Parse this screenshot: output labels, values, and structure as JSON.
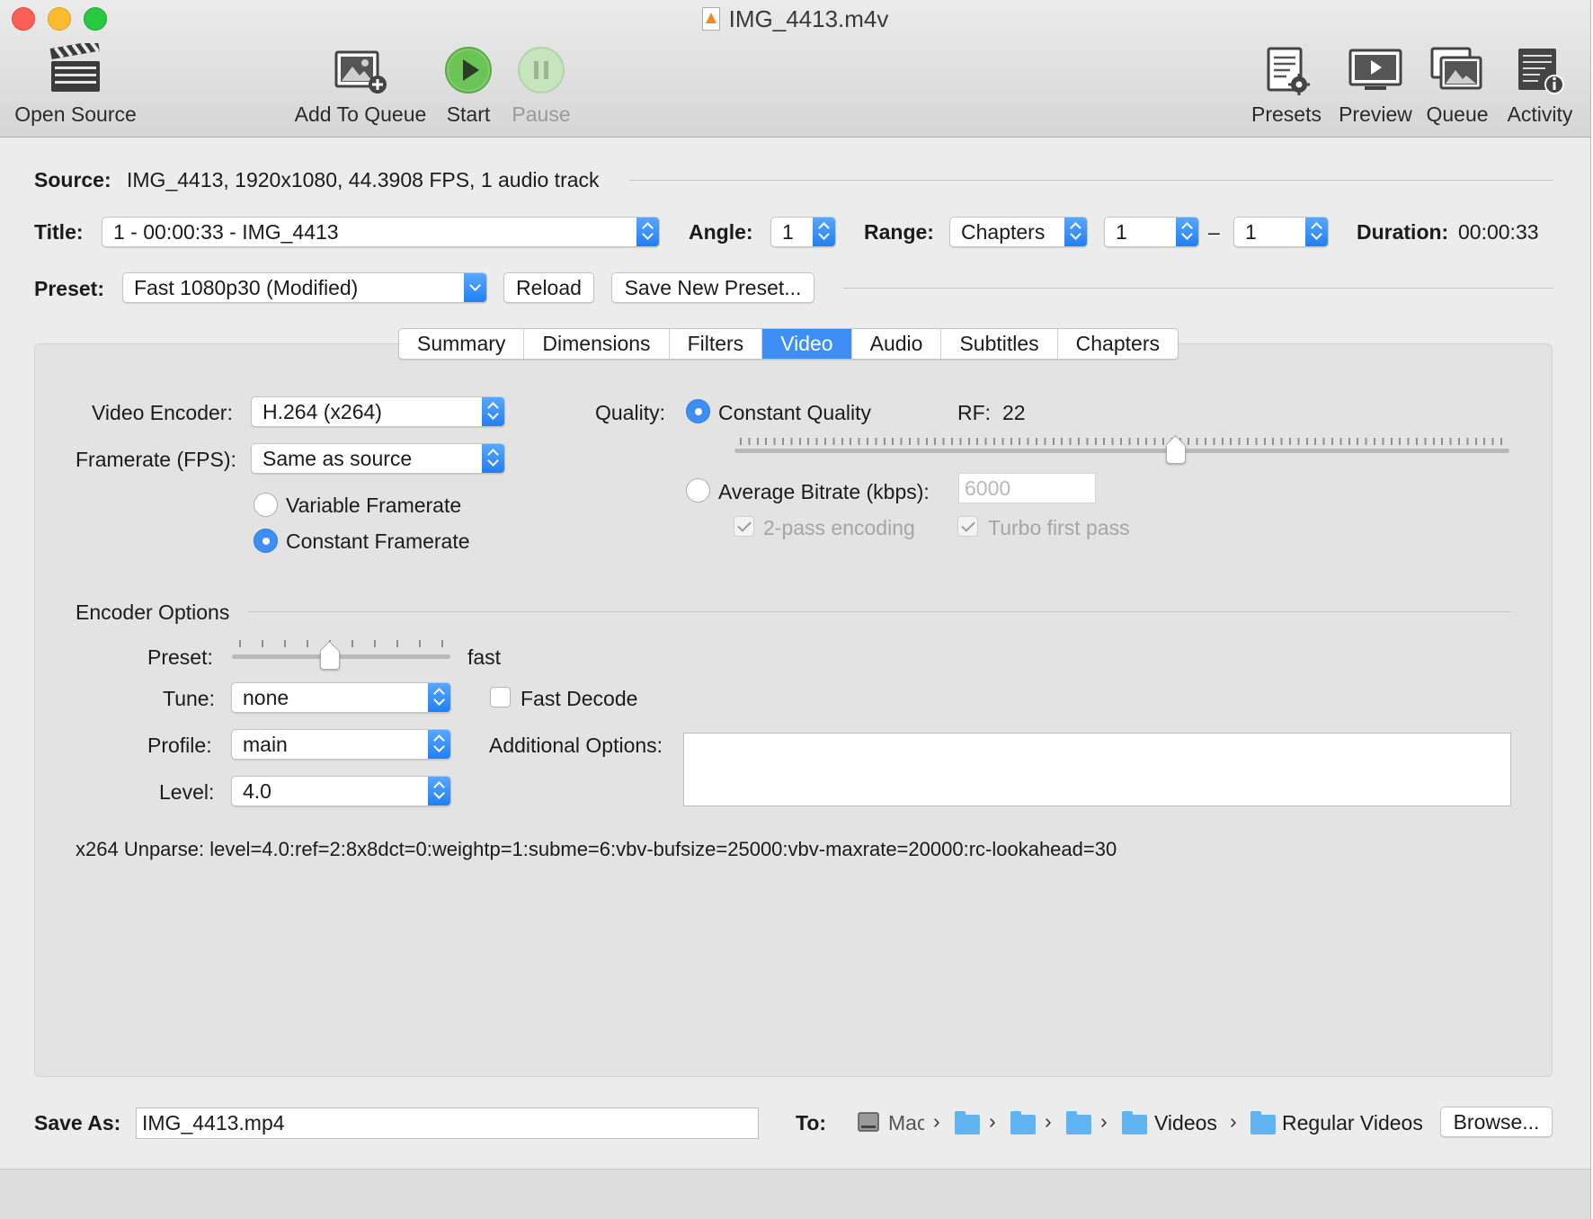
{
  "window": {
    "title": "IMG_4413.m4v"
  },
  "toolbar": {
    "open_source": "Open Source",
    "add_to_queue": "Add To Queue",
    "start": "Start",
    "pause": "Pause",
    "presets": "Presets",
    "preview": "Preview",
    "queue": "Queue",
    "activity": "Activity"
  },
  "source": {
    "label": "Source:",
    "value": "IMG_4413, 1920x1080, 44.3908 FPS, 1 audio track"
  },
  "title_row": {
    "title_label": "Title:",
    "title_value": "1 - 00:00:33 - IMG_4413",
    "angle_label": "Angle:",
    "angle_value": "1",
    "range_label": "Range:",
    "range_value": "Chapters",
    "range_start": "1",
    "range_sep": "–",
    "range_end": "1",
    "duration_label": "Duration:",
    "duration_value": "00:00:33"
  },
  "preset_row": {
    "label": "Preset:",
    "value": "Fast 1080p30 (Modified)",
    "reload": "Reload",
    "save_new": "Save New Preset..."
  },
  "tabs": [
    "Summary",
    "Dimensions",
    "Filters",
    "Video",
    "Audio",
    "Subtitles",
    "Chapters"
  ],
  "active_tab": "Video",
  "video": {
    "encoder_label": "Video Encoder:",
    "encoder_value": "H.264 (x264)",
    "framerate_label": "Framerate (FPS):",
    "framerate_value": "Same as source",
    "variable_framerate": "Variable Framerate",
    "constant_framerate": "Constant Framerate",
    "quality_label": "Quality:",
    "constant_quality": "Constant Quality",
    "rf_label": "RF:",
    "rf_value": "22",
    "rf_slider_fraction": 0.57,
    "average_bitrate": "Average Bitrate (kbps):",
    "bitrate_value": "6000",
    "two_pass": "2-pass encoding",
    "turbo_first_pass": "Turbo first pass"
  },
  "encoder_options": {
    "heading": "Encoder Options",
    "preset_label": "Preset:",
    "preset_value": "fast",
    "preset_slider_fraction": 0.45,
    "tune_label": "Tune:",
    "tune_value": "none",
    "fast_decode": "Fast Decode",
    "profile_label": "Profile:",
    "profile_value": "main",
    "additional_options_label": "Additional Options:",
    "additional_options_value": "",
    "level_label": "Level:",
    "level_value": "4.0",
    "unparse": "x264 Unparse: level=4.0:ref=2:8x8dct=0:weightp=1:subme=6:vbv-bufsize=25000:vbv-maxrate=20000:rc-lookahead=30"
  },
  "save": {
    "label": "Save As:",
    "filename": "IMG_4413.mp4",
    "to_label": "To:",
    "path_disk": "Mac",
    "path_folder": "Videos",
    "path_leaf": "Regular Videos",
    "browse": "Browse..."
  }
}
